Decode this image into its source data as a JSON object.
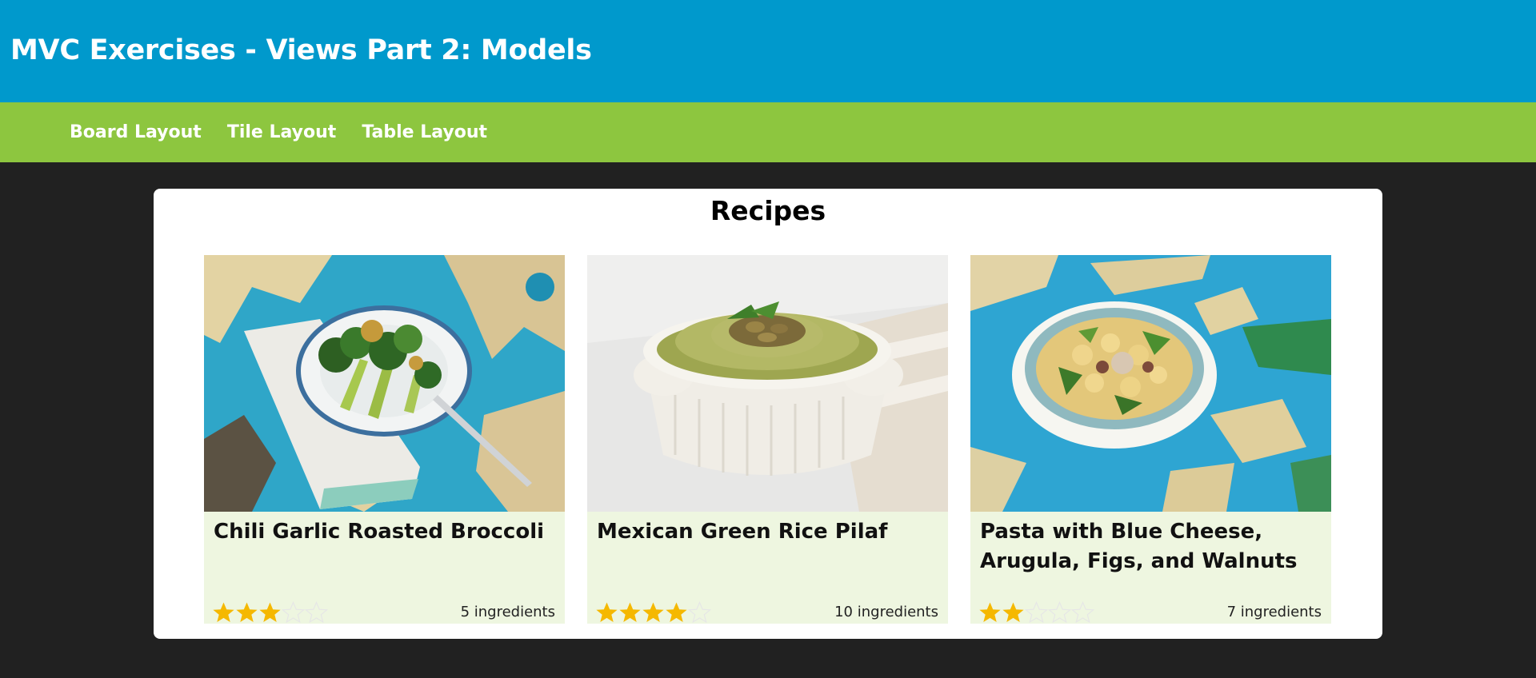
{
  "header": {
    "title": "MVC Exercises - Views Part 2: Models"
  },
  "nav": [
    {
      "label": "Board Layout"
    },
    {
      "label": "Tile Layout"
    },
    {
      "label": "Table Layout"
    }
  ],
  "main": {
    "heading": "Recipes",
    "recipes": [
      {
        "title": "Chili Garlic Roasted Broccoli",
        "rating": 3,
        "max_rating": 5,
        "ingredients": "5 ingredients"
      },
      {
        "title": "Mexican Green Rice Pilaf",
        "rating": 4,
        "max_rating": 5,
        "ingredients": "10 ingredients"
      },
      {
        "title": "Pasta with Blue Cheese, Arugula, Figs, and Walnuts",
        "rating": 2,
        "max_rating": 5,
        "ingredients": "7 ingredients"
      }
    ]
  },
  "colors": {
    "header_bg": "#0099cc",
    "nav_bg": "#8dc63f",
    "page_bg": "#212121",
    "card_bg": "#eef6e0",
    "star_filled": "#f5b800",
    "star_empty": "#e6e6e6"
  }
}
